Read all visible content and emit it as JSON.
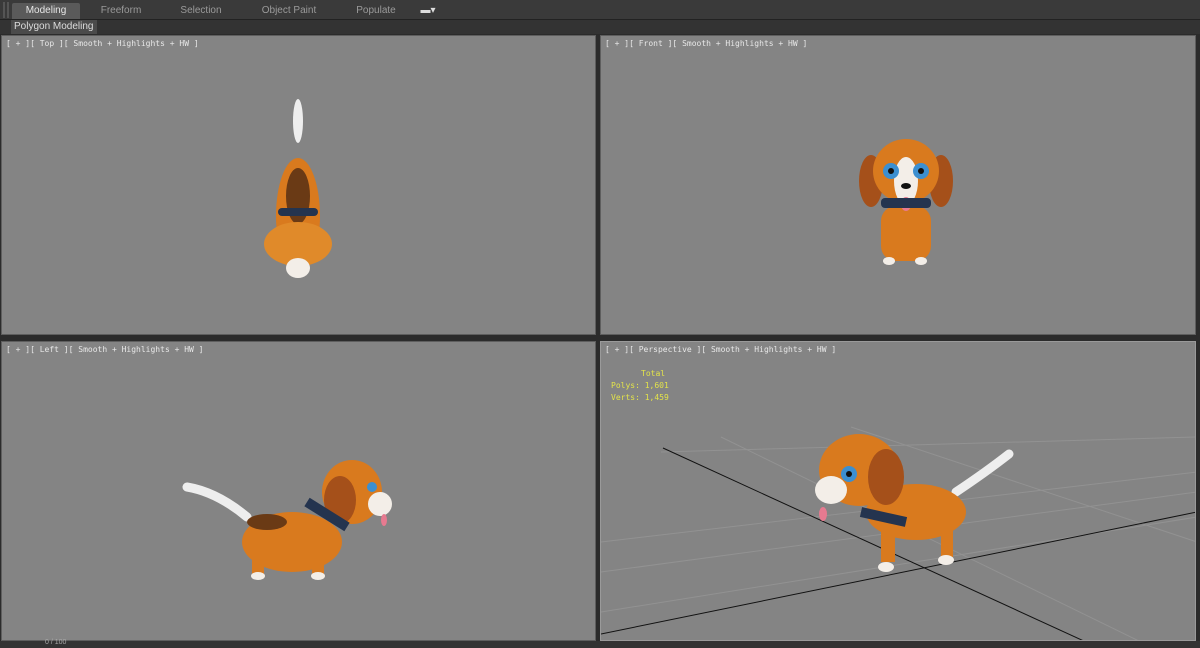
{
  "ribbon": {
    "tabs": [
      {
        "label": "Modeling",
        "active": true
      },
      {
        "label": "Freeform"
      },
      {
        "label": "Selection"
      },
      {
        "label": "Object Paint"
      },
      {
        "label": "Populate"
      }
    ],
    "sub_label": "Polygon Modeling"
  },
  "viewports": {
    "top": {
      "label": "[ + ][ Top ][ Smooth + Highlights + HW ]"
    },
    "front": {
      "label": "[ + ][ Front ][ Smooth + Highlights + HW ]"
    },
    "left": {
      "label": "[ + ][ Left ][ Smooth + Highlights + HW ]"
    },
    "perspective": {
      "label": "[ + ][ Perspective ][ Smooth + Highlights + HW ]",
      "stats": {
        "header": "Total",
        "polys": "Polys: 1,601",
        "verts": "Verts: 1,459"
      }
    }
  },
  "status": {
    "frame": "0 / 100"
  },
  "colors": {
    "viewport": "#848484",
    "fur": "#d97a1e",
    "stats": "#e3e34a"
  }
}
